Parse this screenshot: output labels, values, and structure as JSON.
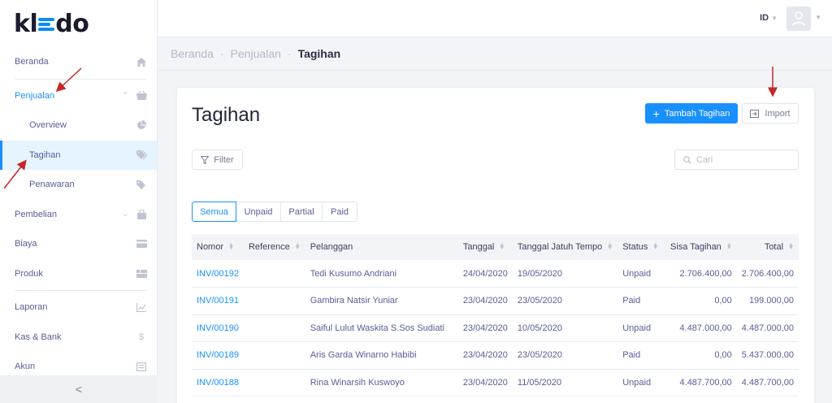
{
  "app": {
    "logo": "kledo"
  },
  "sidebar": {
    "items": [
      {
        "label": "Beranda",
        "icon": "home-icon"
      },
      {
        "label": "Penjualan",
        "icon": "basket-icon"
      },
      {
        "label": "Overview",
        "icon": "pie-chart-icon"
      },
      {
        "label": "Tagihan",
        "icon": "tags-icon"
      },
      {
        "label": "Penawaran",
        "icon": "tag-icon"
      },
      {
        "label": "Pembelian",
        "icon": "shopping-bag-icon"
      },
      {
        "label": "Biaya",
        "icon": "credit-card-icon"
      },
      {
        "label": "Produk",
        "icon": "products-icon"
      },
      {
        "label": "Laporan",
        "icon": "line-chart-icon"
      },
      {
        "label": "Kas & Bank",
        "icon": "dollar-icon"
      },
      {
        "label": "Akun",
        "icon": "ledger-icon"
      }
    ],
    "collapse_label": "<"
  },
  "topbar": {
    "language": "ID"
  },
  "breadcrumb": {
    "home": "Beranda",
    "section": "Penjualan",
    "current": "Tagihan"
  },
  "page": {
    "title": "Tagihan",
    "add_button": "Tambah Tagihan",
    "import_button": "Import",
    "filter_button": "Filter",
    "search_placeholder": "Cari"
  },
  "tabs": [
    {
      "label": "Semua",
      "active": true
    },
    {
      "label": "Unpaid",
      "active": false
    },
    {
      "label": "Partial",
      "active": false
    },
    {
      "label": "Paid",
      "active": false
    }
  ],
  "table": {
    "headers": [
      "Nomor",
      "Reference",
      "Pelanggan",
      "Tanggal",
      "Tanggal Jatuh Tempo",
      "Status",
      "Sisa Tagihan",
      "Total"
    ],
    "rows": [
      {
        "nomor": "INV/00192",
        "reference": "",
        "pelanggan": "Tedi Kusumo Andriani",
        "tanggal": "24/04/2020",
        "jatuh_tempo": "19/05/2020",
        "status": "Unpaid",
        "sisa": "2.706.400,00",
        "total": "2.706.400,00"
      },
      {
        "nomor": "INV/00191",
        "reference": "",
        "pelanggan": "Gambira Natsir Yuniar",
        "tanggal": "23/04/2020",
        "jatuh_tempo": "23/05/2020",
        "status": "Paid",
        "sisa": "0,00",
        "total": "199.000,00"
      },
      {
        "nomor": "INV/00190",
        "reference": "",
        "pelanggan": "Saiful Lulut Waskita S.Sos Sudiati",
        "tanggal": "23/04/2020",
        "jatuh_tempo": "10/05/2020",
        "status": "Unpaid",
        "sisa": "4.487.000,00",
        "total": "4.487.000,00"
      },
      {
        "nomor": "INV/00189",
        "reference": "",
        "pelanggan": "Aris Garda Winarno Habibi",
        "tanggal": "23/04/2020",
        "jatuh_tempo": "23/05/2020",
        "status": "Paid",
        "sisa": "0,00",
        "total": "5.437.000,00"
      },
      {
        "nomor": "INV/00188",
        "reference": "",
        "pelanggan": "Rina Winarsih Kuswoyo",
        "tanggal": "23/04/2020",
        "jatuh_tempo": "11/05/2020",
        "status": "Unpaid",
        "sisa": "4.487.700,00",
        "total": "4.487.700,00"
      }
    ]
  },
  "colors": {
    "accent": "#1890ff",
    "unpaid": "#e53935",
    "paid": "#2e9e44",
    "annotation": "#c62828"
  }
}
